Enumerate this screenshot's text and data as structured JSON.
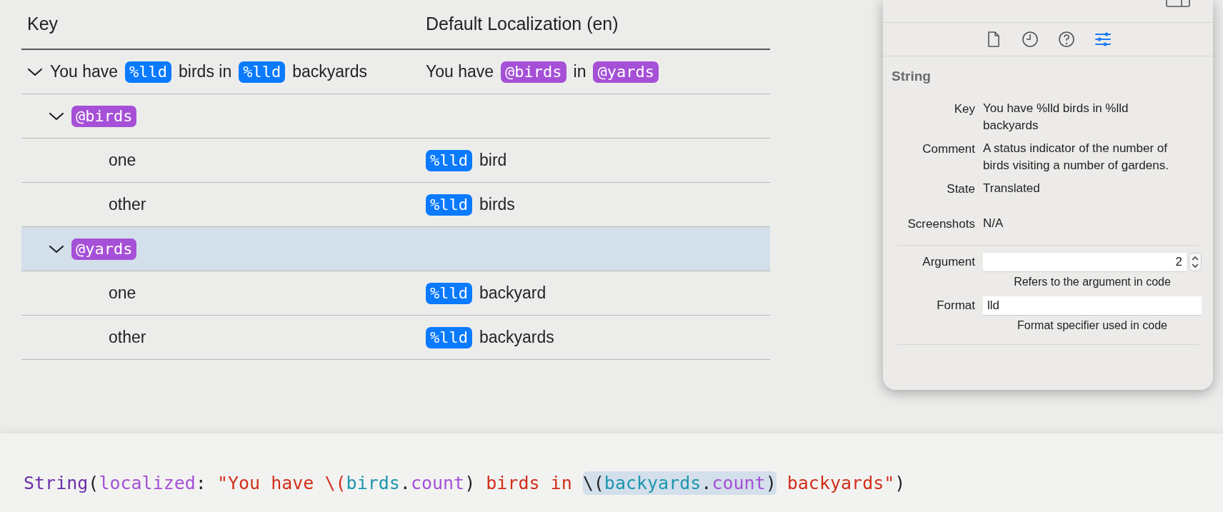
{
  "table": {
    "columns": [
      "Key",
      "Default Localization (en)"
    ],
    "rows": [
      {
        "expanded": true,
        "selected": false,
        "key": [
          {
            "kind": "text",
            "text": "You have"
          },
          {
            "kind": "token",
            "text": "%lld",
            "color": "#0a7aff"
          },
          {
            "kind": "text",
            "text": "birds in"
          },
          {
            "kind": "token",
            "text": "%lld",
            "color": "#0a7aff"
          },
          {
            "kind": "text",
            "text": "backyards"
          }
        ],
        "value": [
          {
            "kind": "text",
            "text": "You have"
          },
          {
            "kind": "token",
            "text": "@birds",
            "color": "#a550d6"
          },
          {
            "kind": "text",
            "text": "in"
          },
          {
            "kind": "token",
            "text": "@yards",
            "color": "#a550d6"
          }
        ],
        "children": [
          {
            "expanded": true,
            "selected": false,
            "key": [
              {
                "kind": "token",
                "text": "@birds",
                "color": "#a550d6"
              }
            ],
            "children": [
              {
                "selected": false,
                "key": [
                  {
                    "kind": "text",
                    "text": "one"
                  }
                ],
                "value": [
                  {
                    "kind": "token",
                    "text": "%lld",
                    "color": "#0a7aff"
                  },
                  {
                    "kind": "text",
                    "text": "bird"
                  }
                ]
              },
              {
                "selected": false,
                "key": [
                  {
                    "kind": "text",
                    "text": "other"
                  }
                ],
                "value": [
                  {
                    "kind": "token",
                    "text": "%lld",
                    "color": "#0a7aff"
                  },
                  {
                    "kind": "text",
                    "text": "birds"
                  }
                ]
              }
            ]
          },
          {
            "expanded": true,
            "selected": true,
            "key": [
              {
                "kind": "token",
                "text": "@yards",
                "color": "#a550d6"
              }
            ],
            "children": [
              {
                "selected": false,
                "key": [
                  {
                    "kind": "text",
                    "text": "one"
                  }
                ],
                "value": [
                  {
                    "kind": "token",
                    "text": "%lld",
                    "color": "#0a7aff"
                  },
                  {
                    "kind": "text",
                    "text": "backyard"
                  }
                ]
              },
              {
                "selected": false,
                "key": [
                  {
                    "kind": "text",
                    "text": "other"
                  }
                ],
                "value": [
                  {
                    "kind": "token",
                    "text": "%lld",
                    "color": "#0a7aff"
                  },
                  {
                    "kind": "text",
                    "text": "backyards"
                  }
                ]
              }
            ]
          }
        ]
      }
    ]
  },
  "inspector": {
    "tabs": [
      {
        "kind": "file",
        "selected": false
      },
      {
        "kind": "history",
        "selected": false
      },
      {
        "kind": "help",
        "selected": false
      },
      {
        "kind": "attributes",
        "selected": true
      }
    ],
    "section_title": "String",
    "info": [
      {
        "label": "Key",
        "value": "You have %lld birds in %lld backyards"
      },
      {
        "label": "Comment",
        "value": "A status indicator of the number of birds visiting a number of gardens."
      },
      {
        "label": "State",
        "value": "Translated"
      },
      {
        "label": "Screenshots",
        "value": "N/A"
      }
    ],
    "fields": [
      {
        "kind": "stepper",
        "label": "Argument",
        "value": "2",
        "hint": "Refers to the argument in code"
      },
      {
        "kind": "text",
        "label": "Format",
        "value": "lld",
        "hint": "Format specifier used in code"
      }
    ]
  },
  "code": [
    {
      "kind": "type",
      "text": "String"
    },
    {
      "kind": "plain",
      "text": "("
    },
    {
      "kind": "param",
      "text": "localized"
    },
    {
      "kind": "plain",
      "text": ": "
    },
    {
      "kind": "string",
      "text": "\"You have \\("
    },
    {
      "kind": "ident",
      "text": "birds"
    },
    {
      "kind": "plain",
      "text": "."
    },
    {
      "kind": "param",
      "text": "count"
    },
    {
      "kind": "plain",
      "text": ")"
    },
    {
      "kind": "string",
      "text": " birds in "
    },
    {
      "kind": "group",
      "highlighted": true,
      "parts": [
        {
          "kind": "plain",
          "text": "\\("
        },
        {
          "kind": "ident",
          "text": "backyards"
        },
        {
          "kind": "plain",
          "text": "."
        },
        {
          "kind": "param",
          "text": "count"
        },
        {
          "kind": "plain",
          "text": ")"
        }
      ]
    },
    {
      "kind": "string",
      "text": " backyards\""
    },
    {
      "kind": "plain",
      "text": ")"
    }
  ]
}
